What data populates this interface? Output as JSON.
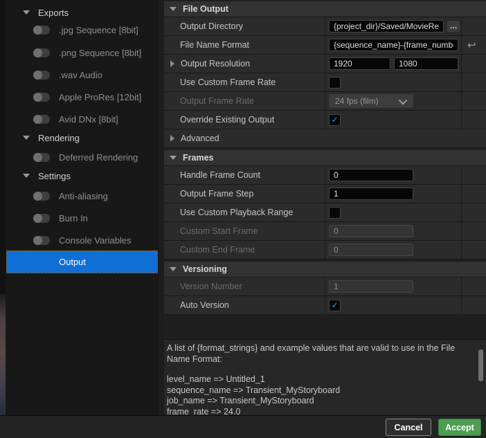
{
  "sidebar": {
    "sections": [
      {
        "label": "Exports",
        "items": [
          {
            "label": ".jpg Sequence [8bit]",
            "toggle": "off"
          },
          {
            "label": ".png Sequence [8bit]",
            "toggle": "off"
          },
          {
            "label": ".wav Audio",
            "toggle": "off"
          },
          {
            "label": "Apple ProRes [12bit]",
            "toggle": "off"
          },
          {
            "label": "Avid DNx [8bit]",
            "toggle": "off"
          }
        ]
      },
      {
        "label": "Rendering",
        "items": [
          {
            "label": "Deferred Rendering",
            "toggle": "off"
          }
        ]
      },
      {
        "label": "Settings",
        "items": [
          {
            "label": "Anti-aliasing",
            "toggle": "off"
          },
          {
            "label": "Burn In",
            "toggle": "off"
          },
          {
            "label": "Console Variables",
            "toggle": "off"
          },
          {
            "label": "Output",
            "selected": true
          }
        ]
      }
    ]
  },
  "panel": {
    "file_output": {
      "title": "File Output",
      "output_directory_label": "Output Directory",
      "output_directory_value": "{project_dir}/Saved/MovieRen",
      "file_name_format_label": "File Name Format",
      "file_name_format_value": "{sequence_name}-{frame_number",
      "output_resolution_label": "Output Resolution",
      "resolution_width": "1920",
      "resolution_height": "1080",
      "use_custom_frame_rate_label": "Use Custom Frame Rate",
      "use_custom_frame_rate_checked": false,
      "output_frame_rate_label": "Output Frame Rate",
      "output_frame_rate_value": "24 fps (film)",
      "override_existing_output_label": "Override Existing Output",
      "override_existing_output_checked": true,
      "advanced_label": "Advanced"
    },
    "frames": {
      "title": "Frames",
      "handle_frame_count_label": "Handle Frame Count",
      "handle_frame_count_value": "0",
      "output_frame_step_label": "Output Frame Step",
      "output_frame_step_value": "1",
      "use_custom_playback_range_label": "Use Custom Playback Range",
      "use_custom_playback_range_checked": false,
      "custom_start_frame_label": "Custom Start Frame",
      "custom_start_frame_value": "0",
      "custom_end_frame_label": "Custom End Frame",
      "custom_end_frame_value": "0"
    },
    "versioning": {
      "title": "Versioning",
      "version_number_label": "Version Number",
      "version_number_value": "1",
      "auto_version_label": "Auto Version",
      "auto_version_checked": true
    }
  },
  "description": {
    "line1": "A list of {format_strings} and example values that are valid to use in the File Name Format:",
    "line3": "level_name => Untitled_1",
    "line4": "sequence_name => Transient_MyStoryboard",
    "line5": "job_name => Transient_MyStoryboard",
    "line6": "frame_rate => 24.0"
  },
  "footer": {
    "cancel_label": "Cancel",
    "accept_label": "Accept"
  },
  "icons": {
    "check": "✓",
    "browse": "…",
    "reset": "↩"
  },
  "colors": {
    "selection_blue": "#0f6fd7",
    "check_blue": "#2b9aff",
    "accept_green": "#4e9e52",
    "focus_dotted_orange": "#c8a050"
  }
}
